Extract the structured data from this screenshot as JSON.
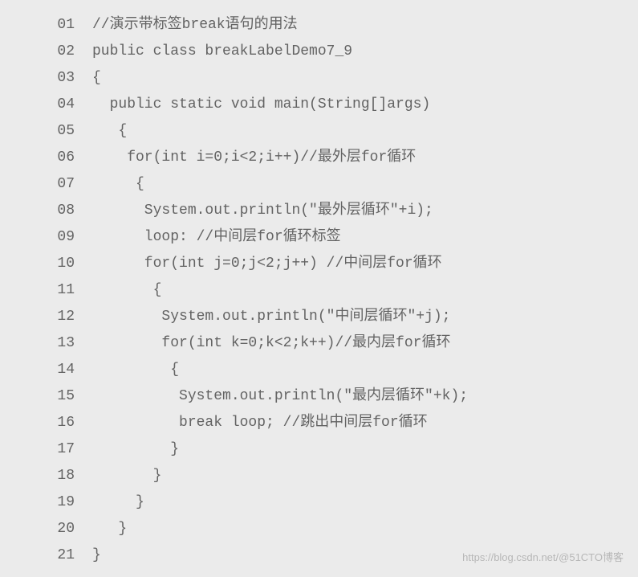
{
  "code": {
    "lines": [
      {
        "num": "01",
        "text": "//演示带标签break语句的用法"
      },
      {
        "num": "02",
        "text": "public class breakLabelDemo7_9"
      },
      {
        "num": "03",
        "text": "{"
      },
      {
        "num": "04",
        "text": "  public static void main(String[]args)"
      },
      {
        "num": "05",
        "text": "   {"
      },
      {
        "num": "06",
        "text": "    for(int i=0;i<2;i++)//最外层for循环"
      },
      {
        "num": "07",
        "text": "     {"
      },
      {
        "num": "08",
        "text": "      System.out.println(\"最外层循环\"+i);"
      },
      {
        "num": "09",
        "text": "      loop: //中间层for循环标签"
      },
      {
        "num": "10",
        "text": "      for(int j=0;j<2;j++) //中间层for循环"
      },
      {
        "num": "11",
        "text": "       {"
      },
      {
        "num": "12",
        "text": "        System.out.println(\"中间层循环\"+j);"
      },
      {
        "num": "13",
        "text": "        for(int k=0;k<2;k++)//最内层for循环"
      },
      {
        "num": "14",
        "text": "         {"
      },
      {
        "num": "15",
        "text": "          System.out.println(\"最内层循环\"+k);"
      },
      {
        "num": "16",
        "text": "          break loop; //跳出中间层for循环"
      },
      {
        "num": "17",
        "text": "         }"
      },
      {
        "num": "18",
        "text": "       }"
      },
      {
        "num": "19",
        "text": "     }"
      },
      {
        "num": "20",
        "text": "   }"
      },
      {
        "num": "21",
        "text": "}"
      }
    ]
  },
  "watermark": "https://blog.csdn.net/@51CTO博客"
}
